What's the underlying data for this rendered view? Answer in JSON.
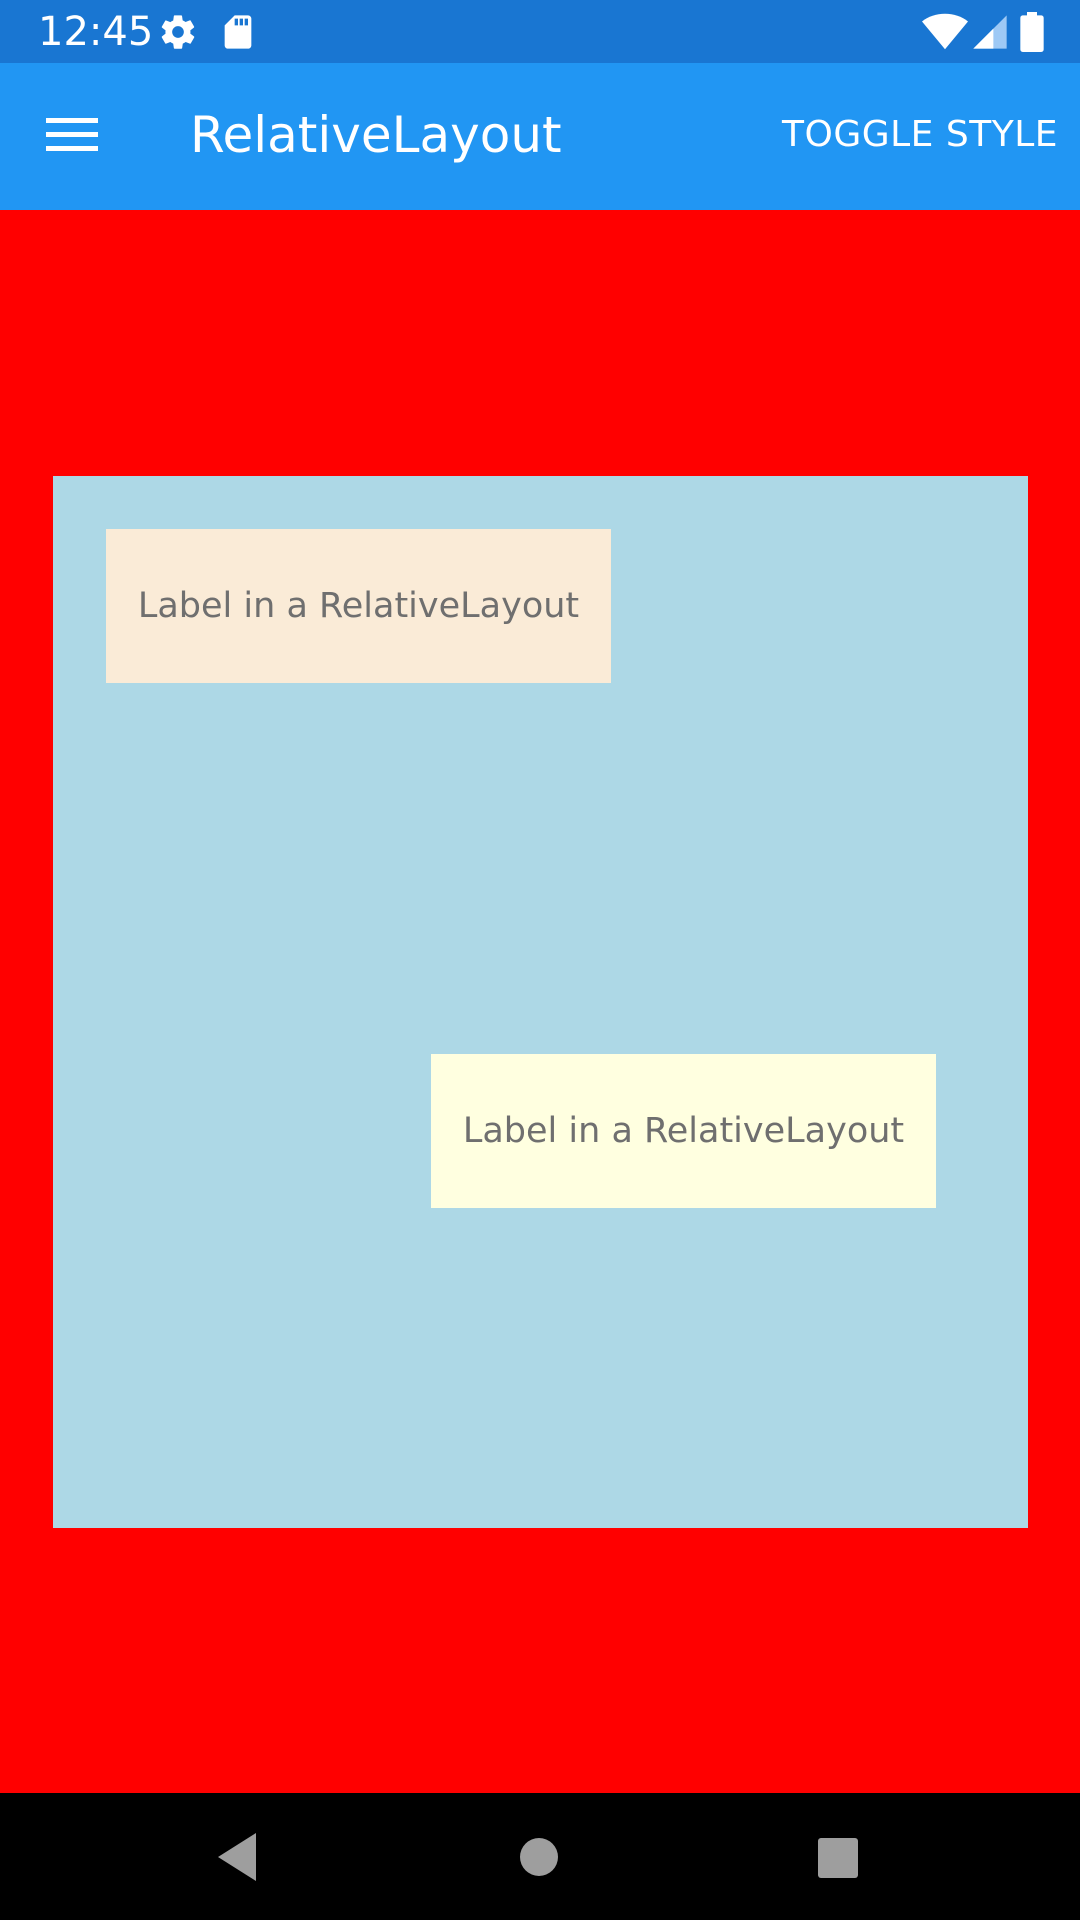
{
  "status_bar": {
    "time": "12:45",
    "icons": [
      "settings-icon",
      "sd-card-icon",
      "wifi-icon",
      "cell-signal-icon",
      "battery-icon"
    ]
  },
  "app_bar": {
    "title": "RelativeLayout",
    "menu_icon": "hamburger-menu-icon",
    "action_label": "TOGGLE STYLE",
    "background": "#2196f3"
  },
  "content": {
    "page_background": "#ff0000",
    "layout_background": "#add8e6",
    "labels": [
      {
        "text": "Label in a RelativeLayout",
        "background": "#faebd7"
      },
      {
        "text": "Label in a RelativeLayout",
        "background": "#ffffe0"
      }
    ]
  },
  "nav_bar": {
    "icons": [
      "back-icon",
      "home-icon",
      "recents-icon"
    ]
  }
}
